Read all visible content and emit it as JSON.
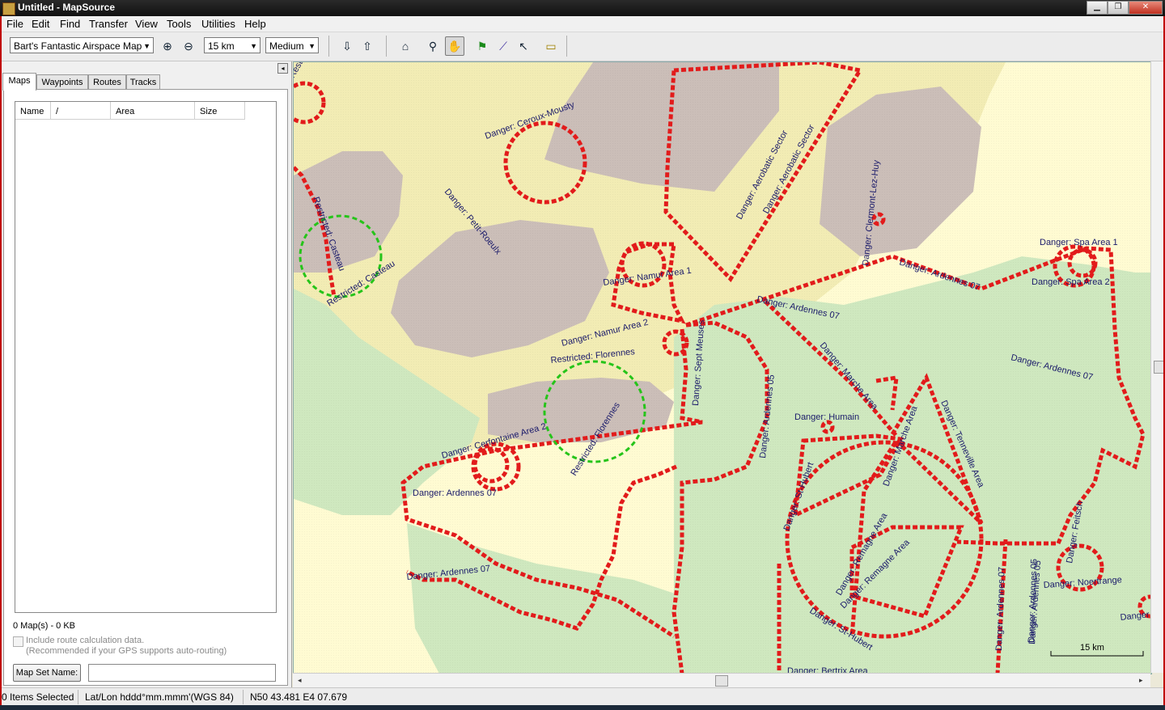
{
  "window": {
    "title": "Untitled - MapSource",
    "minimize": "▁",
    "restore": "❐",
    "close": "✕"
  },
  "menu": [
    "File",
    "Edit",
    "Find",
    "Transfer",
    "View",
    "Tools",
    "Utilities",
    "Help"
  ],
  "toolbar": {
    "map_product": "Bart's Fantastic Airspace Map",
    "zoom_level": "15 km",
    "detail": "Medium"
  },
  "tabs": [
    "Maps",
    "Waypoints",
    "Routes",
    "Tracks"
  ],
  "maps_list": {
    "columns": [
      "Name",
      "/",
      "Area",
      "Size"
    ],
    "summary": "0 Map(s) - 0 KB",
    "route_calc_label": "Include route calculation data.",
    "route_calc_note": "(Recommended if your GPS supports auto-routing)",
    "map_set_button": "Map Set Name:",
    "map_set_value": ""
  },
  "map": {
    "scale_label": "15 km",
    "colors": {
      "base": "#fffbd2",
      "tan": "#f2ecb4",
      "green": "#cfe8bf",
      "gray": "#cbbeb8",
      "airspace": "#e21b1b",
      "restricted": "#26c41a"
    },
    "labels": [
      {
        "text": "Danger: Ceroux-Mousty"
      },
      {
        "text": "Danger: Aerobatic Sector"
      },
      {
        "text": "Danger: Aerobatic Sector"
      },
      {
        "text": "Danger: Clermont-Lez-Huy"
      },
      {
        "text": "Danger: Petit-Roeulx"
      },
      {
        "text": "Restricted: Casteau"
      },
      {
        "text": "Restricted: Casteau"
      },
      {
        "text": "Danger: Namur Area 1"
      },
      {
        "text": "Danger: Namur Area 2"
      },
      {
        "text": "Restricted: Florennes"
      },
      {
        "text": "Restricted: Florennes"
      },
      {
        "text": "Danger: Sept Meuses"
      },
      {
        "text": "Danger: Ardennes 07"
      },
      {
        "text": "Danger: Ardennes 07"
      },
      {
        "text": "Danger: Spa Area 1"
      },
      {
        "text": "Danger: Spa Area 2"
      },
      {
        "text": "Danger: Ardennes 07"
      },
      {
        "text": "Danger: Ardennes 05"
      },
      {
        "text": "Danger: Ardennes 05"
      },
      {
        "text": "Danger: Humain"
      },
      {
        "text": "Danger: Marche Area"
      },
      {
        "text": "Danger: Marche Area"
      },
      {
        "text": "Danger: Tenneville Area"
      },
      {
        "text": "Danger: Cerfontaine Area 2"
      },
      {
        "text": "Danger: Ardennes 07"
      },
      {
        "text": "Danger: Ardennes 07"
      },
      {
        "text": "Danger: St-Hubert"
      },
      {
        "text": "Danger: Remagne Area"
      },
      {
        "text": "Danger: Remagne Area"
      },
      {
        "text": "Danger: St-Hubert"
      },
      {
        "text": "Danger: Ardennes 07"
      },
      {
        "text": "Danger: Ardennes 05"
      },
      {
        "text": "Danger: Feitsch"
      },
      {
        "text": "Danger: Noertrange"
      },
      {
        "text": "Danger: Bertrix Area"
      },
      {
        "text": "Danger"
      },
      {
        "text": "Restricted: Casteau"
      }
    ]
  },
  "statusbar": {
    "selection": "0 Items Selected",
    "format": "Lat/Lon hddd°mm.mmm'(WGS 84)",
    "position": "N50 43.481 E4 07.679"
  }
}
